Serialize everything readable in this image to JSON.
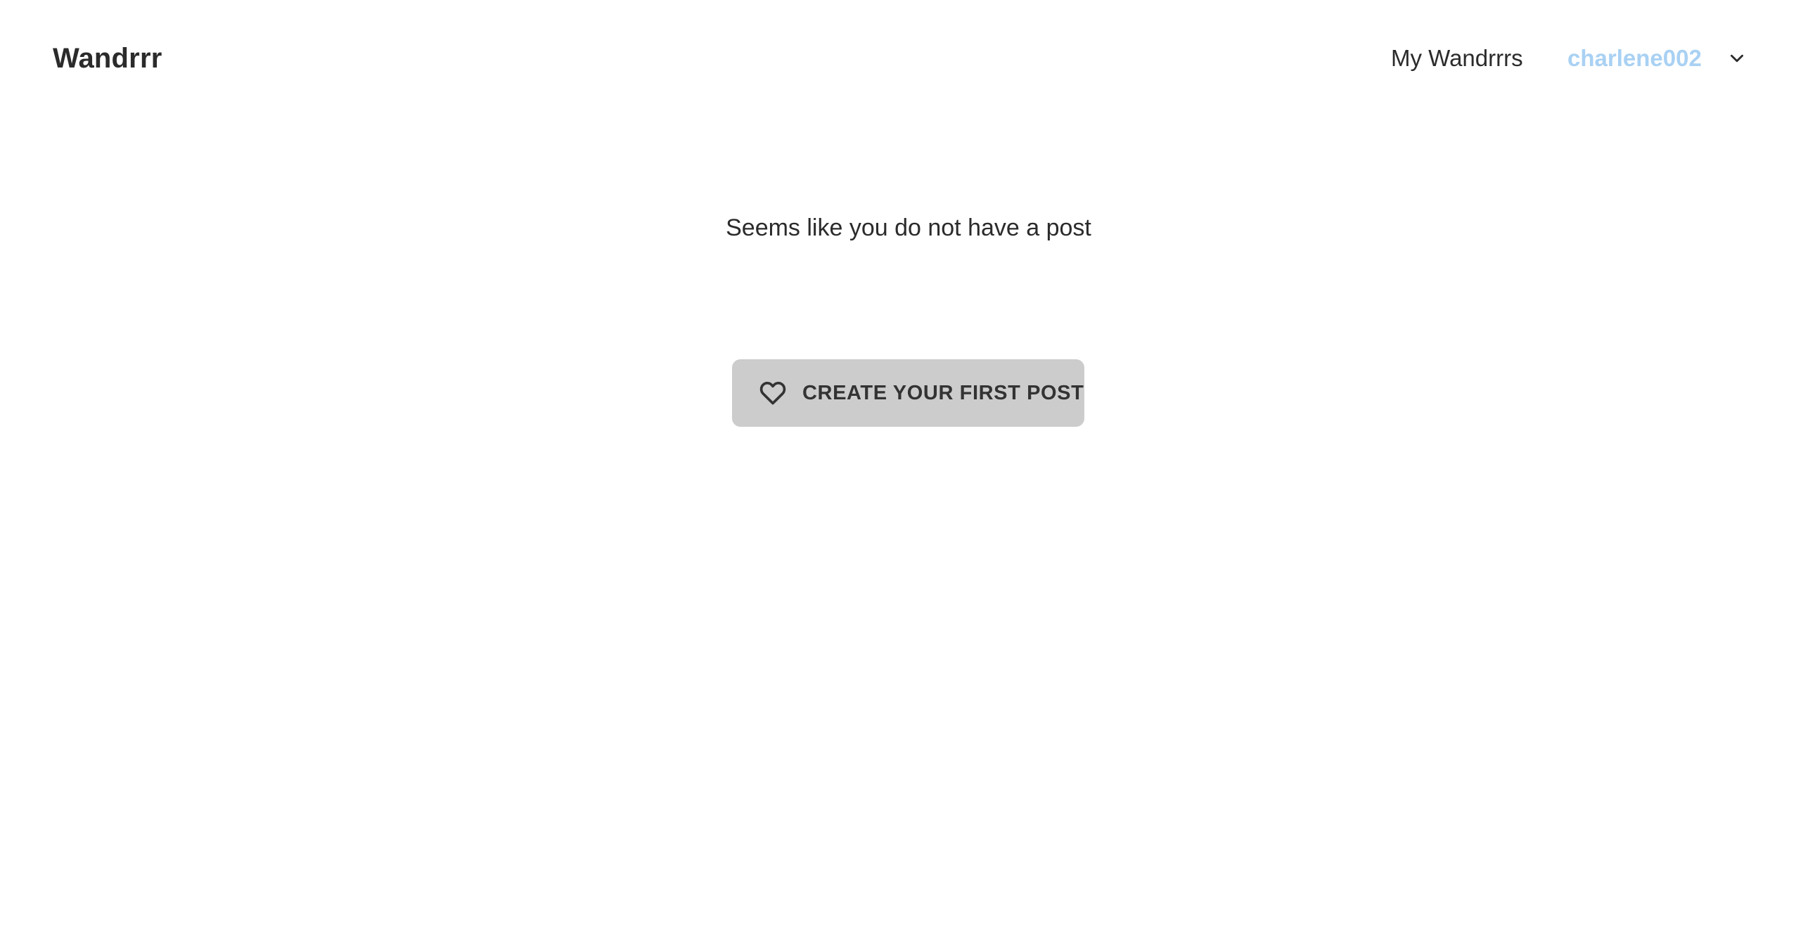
{
  "header": {
    "brand": "Wandrrr",
    "nav_link": "My Wandrrrs",
    "username": "charlene002",
    "username_color": "#a9d1f3",
    "dropdown_icon": "chevron-down-icon"
  },
  "main": {
    "empty_message": "Seems like you do not have a post",
    "create_button": {
      "label": "CREATE YOUR FIRST POST",
      "icon": "heart-icon",
      "background": "#cccccc"
    }
  }
}
